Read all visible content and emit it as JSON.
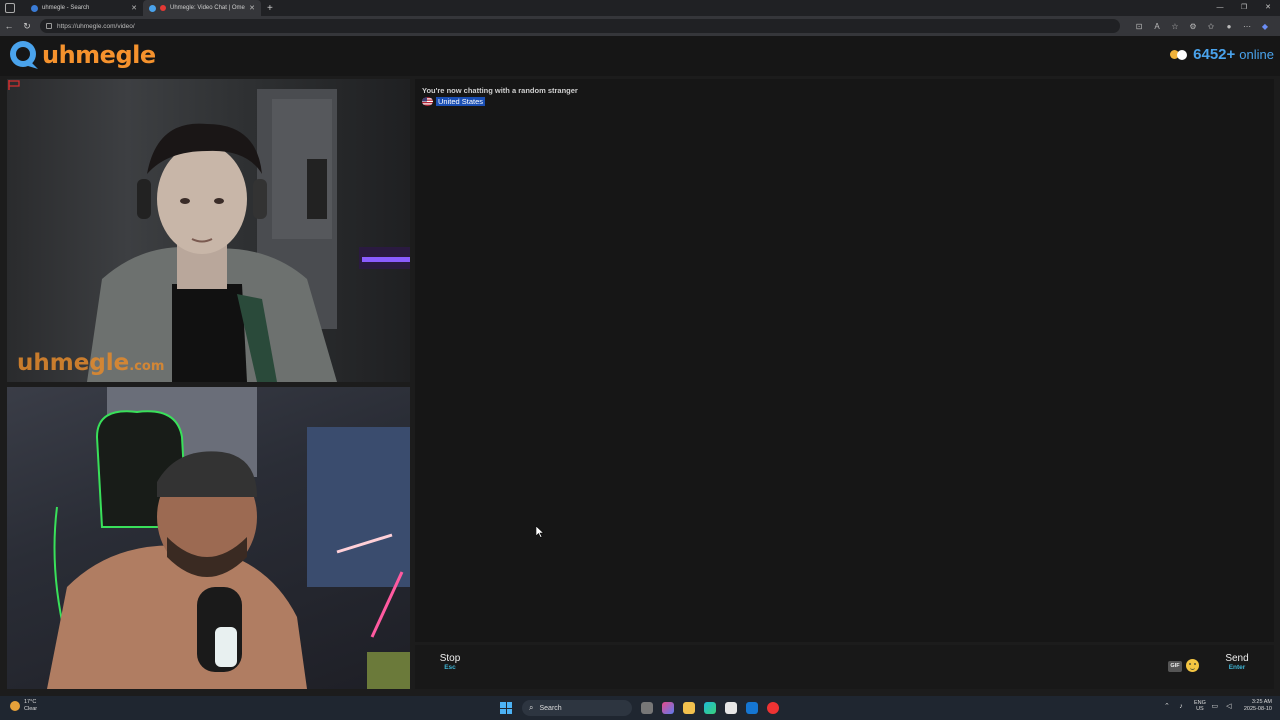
{
  "browser": {
    "tabs": [
      {
        "title": "uhmegle - Search",
        "active": false
      },
      {
        "title": "Uhmegle: Video Chat | Ome",
        "active": true
      }
    ],
    "url": "https://uhmegle.com/video/"
  },
  "site": {
    "logo_text": "uhmegle",
    "online_count": "6452+",
    "online_label": "online",
    "watermark": "uhmegle",
    "watermark_suffix": ".com"
  },
  "chat": {
    "system_message": "You're now chatting with a random stranger",
    "country": "United States"
  },
  "controls": {
    "stop_label": "Stop",
    "stop_key": "Esc",
    "send_label": "Send",
    "send_key": "Enter",
    "gif_label": "GIF",
    "message_placeholder": ""
  },
  "taskbar": {
    "weather_temp": "17°C",
    "weather_cond": "Clear",
    "search_label": "Search",
    "lang_line1": "ENG",
    "lang_line2": "US",
    "time": "3:25 AM",
    "date": "2025-08-10"
  },
  "colors": {
    "brand_orange": "#f5922d",
    "brand_blue": "#4aa3ec",
    "key_hint": "#3fb6d6"
  }
}
